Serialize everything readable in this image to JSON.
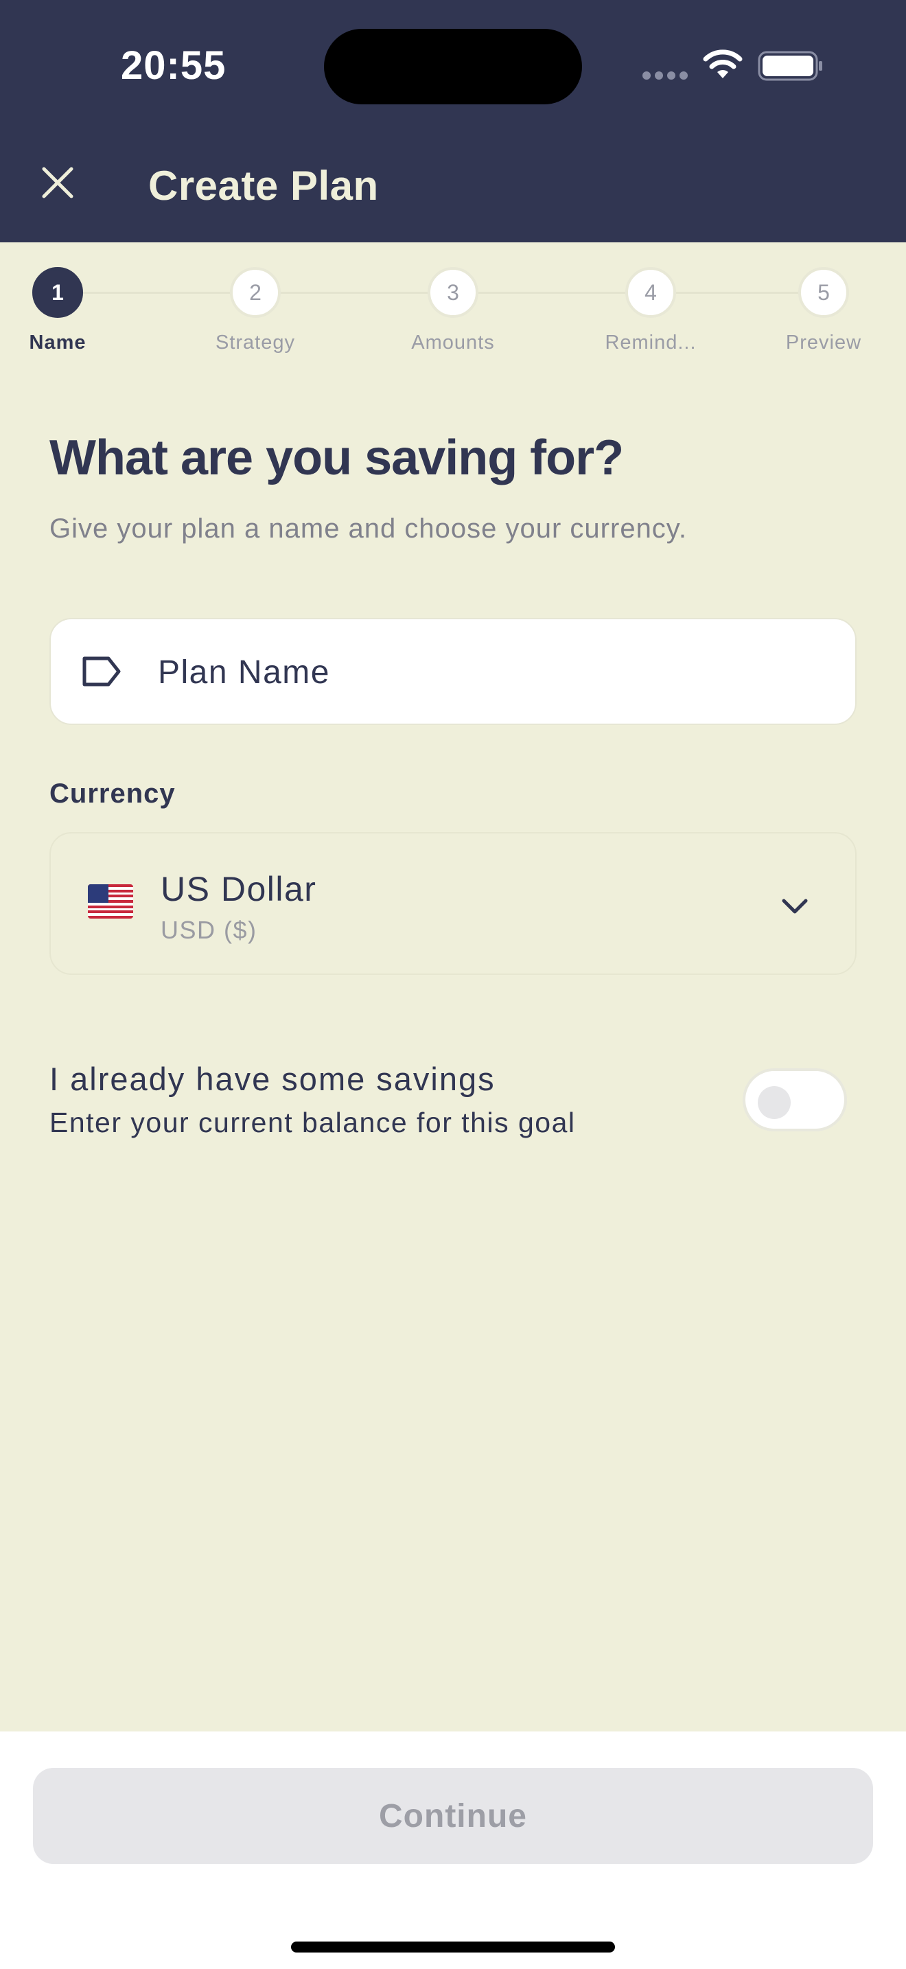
{
  "status_bar": {
    "time": "20:55"
  },
  "header": {
    "title": "Create Plan",
    "close_icon": "close-icon"
  },
  "stepper": {
    "current_step": 1,
    "steps": [
      {
        "number": "1",
        "label": "Name"
      },
      {
        "number": "2",
        "label": "Strategy"
      },
      {
        "number": "3",
        "label": "Amounts"
      },
      {
        "number": "4",
        "label": "Remind..."
      },
      {
        "number": "5",
        "label": "Preview"
      }
    ]
  },
  "content": {
    "heading": "What are you saving for?",
    "subheading": "Give your plan a name and choose your currency.",
    "plan_name": {
      "placeholder": "Plan Name",
      "value": "",
      "icon": "tag-icon"
    },
    "currency": {
      "label": "Currency",
      "selected_name": "US Dollar",
      "selected_code": "USD ($)",
      "flag_icon": "us-flag-icon"
    },
    "savings": {
      "title": "I already have some savings",
      "subtitle": "Enter your current balance for this goal",
      "enabled": false
    }
  },
  "footer": {
    "continue_label": "Continue",
    "continue_enabled": false
  },
  "colors": {
    "header_bg": "#313652",
    "page_bg": "#EFEFDA",
    "accent": "#313652",
    "disabled_button_bg": "#E6E6E9",
    "disabled_button_text": "#9D9EA6"
  }
}
